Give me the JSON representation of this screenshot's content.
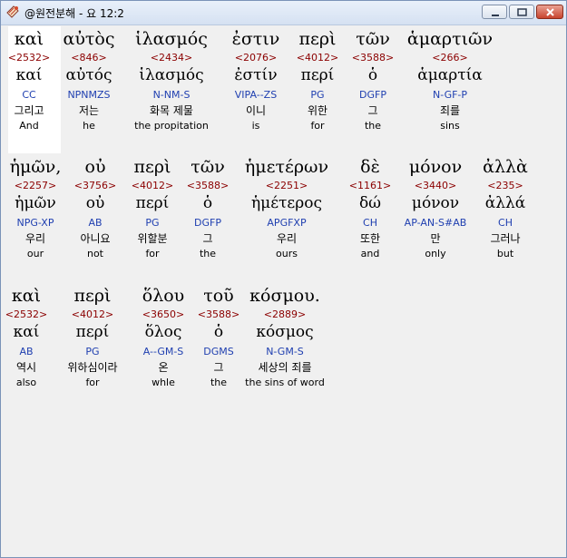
{
  "window": {
    "title": "@원전분해 - 요 12:2",
    "icon": "book-icon",
    "min_icon": "minimize-icon",
    "max_icon": "maximize-icon",
    "close_icon": "close-icon"
  },
  "highlight_color": "#ffffff",
  "lines": [
    {
      "words": [
        {
          "greek": "καὶ",
          "strongs": "<2532>",
          "lemma": "καί",
          "parsing": "CC",
          "korean": "그리고",
          "english": "And"
        },
        {
          "greek": "αὐτὸς",
          "strongs": "<846>",
          "lemma": "αὐτός",
          "parsing": "NPNMZS",
          "korean": "저는",
          "english": "he"
        },
        {
          "greek": "ἱλασμός",
          "strongs": "<2434>",
          "lemma": "ἱλασμός",
          "parsing": "N-NM-S",
          "korean": "화목 제물",
          "english": "the propitation"
        },
        {
          "greek": "ἐστιν",
          "strongs": "<2076>",
          "lemma": "ἐστίν",
          "parsing": "VIPA--ZS",
          "korean": "이니",
          "english": "is"
        },
        {
          "greek": "περὶ",
          "strongs": "<4012>",
          "lemma": "περί",
          "parsing": "PG",
          "korean": "위한",
          "english": "for"
        },
        {
          "greek": "τῶν",
          "strongs": "<3588>",
          "lemma": "ὁ",
          "parsing": "DGFP",
          "korean": "그",
          "english": "the"
        },
        {
          "greek": "ἁμαρτιῶν",
          "strongs": "<266>",
          "lemma": "ἁμαρτία",
          "parsing": "N-GF-P",
          "korean": "죄를",
          "english": "sins"
        }
      ]
    },
    {
      "words": [
        {
          "greek": "ἡμῶν,",
          "strongs": "<2257>",
          "lemma": "ἡμῶν",
          "parsing": "NPG-XP",
          "korean": "우리",
          "english": "our"
        },
        {
          "greek": "οὐ",
          "strongs": "<3756>",
          "lemma": "οὐ",
          "parsing": "AB",
          "korean": "아니요",
          "english": "not"
        },
        {
          "greek": "περὶ",
          "strongs": "<4012>",
          "lemma": "περί",
          "parsing": "PG",
          "korean": "위할분",
          "english": "for"
        },
        {
          "greek": "τῶν",
          "strongs": "<3588>",
          "lemma": "ὁ",
          "parsing": "DGFP",
          "korean": "그",
          "english": "the"
        },
        {
          "greek": "ἡμετέρων",
          "strongs": "<2251>",
          "lemma": "ἡμέτερος",
          "parsing": "APGFXP",
          "korean": "우리",
          "english": "ours"
        },
        {
          "greek": "δὲ",
          "strongs": "<1161>",
          "lemma": "δώ",
          "parsing": "CH",
          "korean": "또한",
          "english": "and"
        },
        {
          "greek": "μόνον",
          "strongs": "<3440>",
          "lemma": "μόνον",
          "parsing": "AP-AN-S#AB",
          "korean": "만",
          "english": "only"
        },
        {
          "greek": "ἀλλὰ",
          "strongs": "<235>",
          "lemma": "ἀλλά",
          "parsing": "CH",
          "korean": "그러나",
          "english": "but"
        }
      ]
    },
    {
      "words": [
        {
          "greek": "καὶ",
          "strongs": "<2532>",
          "lemma": "καί",
          "parsing": "AB",
          "korean": "역시",
          "english": "also"
        },
        {
          "greek": "περὶ",
          "strongs": "<4012>",
          "lemma": "περί",
          "parsing": "PG",
          "korean": "위하심이라",
          "english": "for"
        },
        {
          "greek": "ὅλου",
          "strongs": "<3650>",
          "lemma": "ὅλος",
          "parsing": "A--GM-S",
          "korean": "온",
          "english": "whle"
        },
        {
          "greek": "τοῦ",
          "strongs": "<3588>",
          "lemma": "ὁ",
          "parsing": "DGMS",
          "korean": "그",
          "english": "the"
        },
        {
          "greek": "κόσμου.",
          "strongs": "<2889>",
          "lemma": "κόσμος",
          "parsing": "N-GM-S",
          "korean": "세상의 죄를",
          "english": "the sins of word"
        }
      ]
    }
  ]
}
